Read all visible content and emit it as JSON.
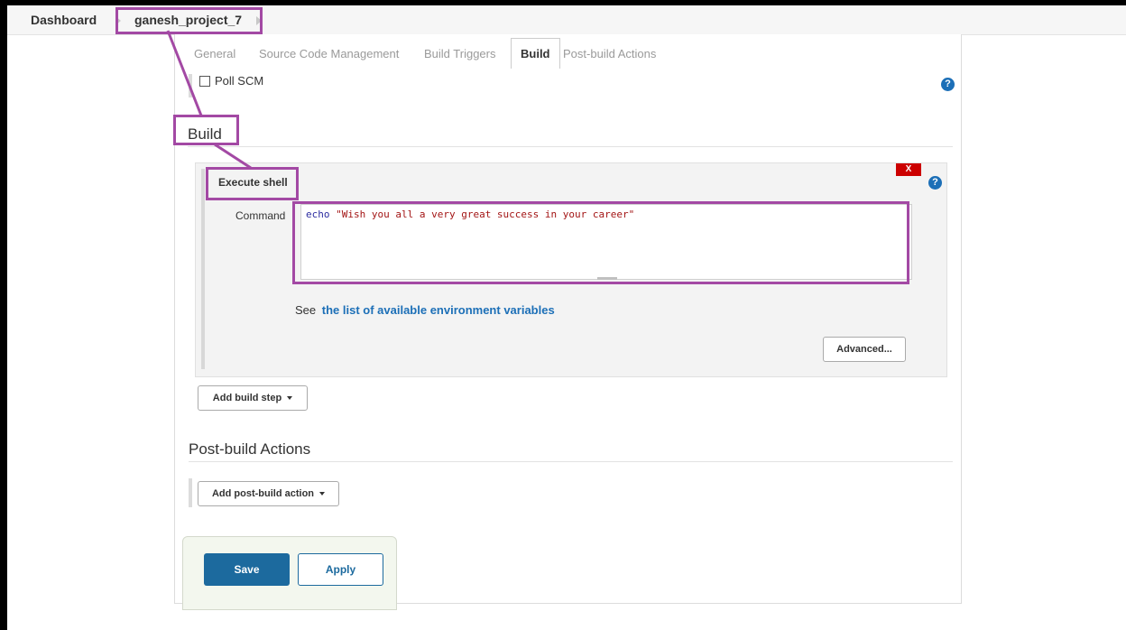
{
  "breadcrumb": {
    "root": "Dashboard",
    "project": "ganesh_project_7"
  },
  "tabs": [
    "General",
    "Source Code Management",
    "Build Triggers",
    "Build",
    "Post-build Actions"
  ],
  "active_tab": "Build",
  "triggers": {
    "poll_scm_label": "Poll SCM",
    "poll_scm_checked": false
  },
  "help_glyph": "?",
  "build": {
    "title": "Build",
    "step_title": "Execute shell",
    "delete_label": "X",
    "command_label": "Command",
    "command_keyword": "echo",
    "command_string": "\"Wish you all a very great success in your career\"",
    "env_prefix": "See",
    "env_link": "the list of available environment variables",
    "advanced_label": "Advanced...",
    "add_step_label": "Add build step"
  },
  "post_build": {
    "title": "Post-build Actions",
    "add_action_label": "Add post-build action"
  },
  "actions": {
    "save_label": "Save",
    "apply_label": "Apply"
  },
  "colors": {
    "accent": "#1c6fb7",
    "annotation": "#a349a4",
    "danger": "#cc0000",
    "save_bg": "#1c6a9e",
    "sticky_bg": "#f3f7ee"
  }
}
